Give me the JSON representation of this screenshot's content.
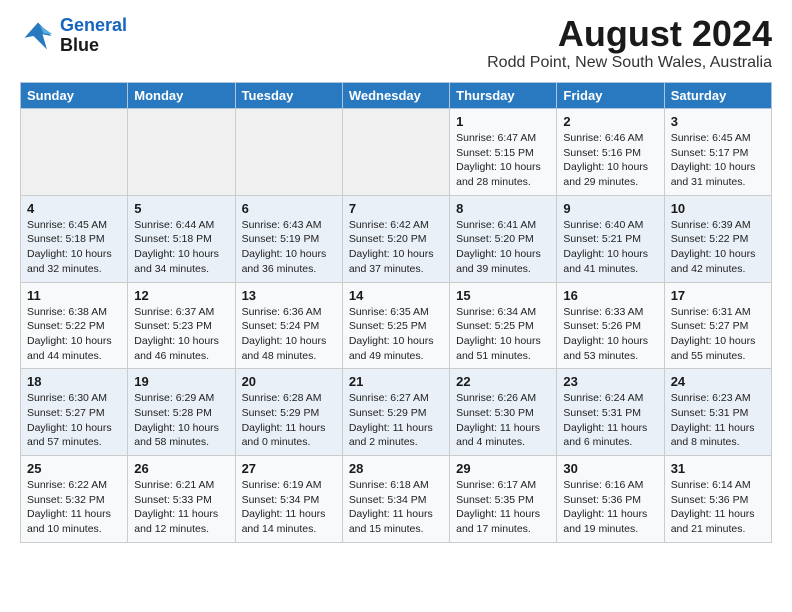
{
  "logo": {
    "line1": "General",
    "line2": "Blue"
  },
  "title": "August 2024",
  "subtitle": "Rodd Point, New South Wales, Australia",
  "days_of_week": [
    "Sunday",
    "Monday",
    "Tuesday",
    "Wednesday",
    "Thursday",
    "Friday",
    "Saturday"
  ],
  "weeks": [
    [
      {
        "day": "",
        "info": ""
      },
      {
        "day": "",
        "info": ""
      },
      {
        "day": "",
        "info": ""
      },
      {
        "day": "",
        "info": ""
      },
      {
        "day": "1",
        "info": "Sunrise: 6:47 AM\nSunset: 5:15 PM\nDaylight: 10 hours\nand 28 minutes."
      },
      {
        "day": "2",
        "info": "Sunrise: 6:46 AM\nSunset: 5:16 PM\nDaylight: 10 hours\nand 29 minutes."
      },
      {
        "day": "3",
        "info": "Sunrise: 6:45 AM\nSunset: 5:17 PM\nDaylight: 10 hours\nand 31 minutes."
      }
    ],
    [
      {
        "day": "4",
        "info": "Sunrise: 6:45 AM\nSunset: 5:18 PM\nDaylight: 10 hours\nand 32 minutes."
      },
      {
        "day": "5",
        "info": "Sunrise: 6:44 AM\nSunset: 5:18 PM\nDaylight: 10 hours\nand 34 minutes."
      },
      {
        "day": "6",
        "info": "Sunrise: 6:43 AM\nSunset: 5:19 PM\nDaylight: 10 hours\nand 36 minutes."
      },
      {
        "day": "7",
        "info": "Sunrise: 6:42 AM\nSunset: 5:20 PM\nDaylight: 10 hours\nand 37 minutes."
      },
      {
        "day": "8",
        "info": "Sunrise: 6:41 AM\nSunset: 5:20 PM\nDaylight: 10 hours\nand 39 minutes."
      },
      {
        "day": "9",
        "info": "Sunrise: 6:40 AM\nSunset: 5:21 PM\nDaylight: 10 hours\nand 41 minutes."
      },
      {
        "day": "10",
        "info": "Sunrise: 6:39 AM\nSunset: 5:22 PM\nDaylight: 10 hours\nand 42 minutes."
      }
    ],
    [
      {
        "day": "11",
        "info": "Sunrise: 6:38 AM\nSunset: 5:22 PM\nDaylight: 10 hours\nand 44 minutes."
      },
      {
        "day": "12",
        "info": "Sunrise: 6:37 AM\nSunset: 5:23 PM\nDaylight: 10 hours\nand 46 minutes."
      },
      {
        "day": "13",
        "info": "Sunrise: 6:36 AM\nSunset: 5:24 PM\nDaylight: 10 hours\nand 48 minutes."
      },
      {
        "day": "14",
        "info": "Sunrise: 6:35 AM\nSunset: 5:25 PM\nDaylight: 10 hours\nand 49 minutes."
      },
      {
        "day": "15",
        "info": "Sunrise: 6:34 AM\nSunset: 5:25 PM\nDaylight: 10 hours\nand 51 minutes."
      },
      {
        "day": "16",
        "info": "Sunrise: 6:33 AM\nSunset: 5:26 PM\nDaylight: 10 hours\nand 53 minutes."
      },
      {
        "day": "17",
        "info": "Sunrise: 6:31 AM\nSunset: 5:27 PM\nDaylight: 10 hours\nand 55 minutes."
      }
    ],
    [
      {
        "day": "18",
        "info": "Sunrise: 6:30 AM\nSunset: 5:27 PM\nDaylight: 10 hours\nand 57 minutes."
      },
      {
        "day": "19",
        "info": "Sunrise: 6:29 AM\nSunset: 5:28 PM\nDaylight: 10 hours\nand 58 minutes."
      },
      {
        "day": "20",
        "info": "Sunrise: 6:28 AM\nSunset: 5:29 PM\nDaylight: 11 hours\nand 0 minutes."
      },
      {
        "day": "21",
        "info": "Sunrise: 6:27 AM\nSunset: 5:29 PM\nDaylight: 11 hours\nand 2 minutes."
      },
      {
        "day": "22",
        "info": "Sunrise: 6:26 AM\nSunset: 5:30 PM\nDaylight: 11 hours\nand 4 minutes."
      },
      {
        "day": "23",
        "info": "Sunrise: 6:24 AM\nSunset: 5:31 PM\nDaylight: 11 hours\nand 6 minutes."
      },
      {
        "day": "24",
        "info": "Sunrise: 6:23 AM\nSunset: 5:31 PM\nDaylight: 11 hours\nand 8 minutes."
      }
    ],
    [
      {
        "day": "25",
        "info": "Sunrise: 6:22 AM\nSunset: 5:32 PM\nDaylight: 11 hours\nand 10 minutes."
      },
      {
        "day": "26",
        "info": "Sunrise: 6:21 AM\nSunset: 5:33 PM\nDaylight: 11 hours\nand 12 minutes."
      },
      {
        "day": "27",
        "info": "Sunrise: 6:19 AM\nSunset: 5:34 PM\nDaylight: 11 hours\nand 14 minutes."
      },
      {
        "day": "28",
        "info": "Sunrise: 6:18 AM\nSunset: 5:34 PM\nDaylight: 11 hours\nand 15 minutes."
      },
      {
        "day": "29",
        "info": "Sunrise: 6:17 AM\nSunset: 5:35 PM\nDaylight: 11 hours\nand 17 minutes."
      },
      {
        "day": "30",
        "info": "Sunrise: 6:16 AM\nSunset: 5:36 PM\nDaylight: 11 hours\nand 19 minutes."
      },
      {
        "day": "31",
        "info": "Sunrise: 6:14 AM\nSunset: 5:36 PM\nDaylight: 11 hours\nand 21 minutes."
      }
    ]
  ]
}
